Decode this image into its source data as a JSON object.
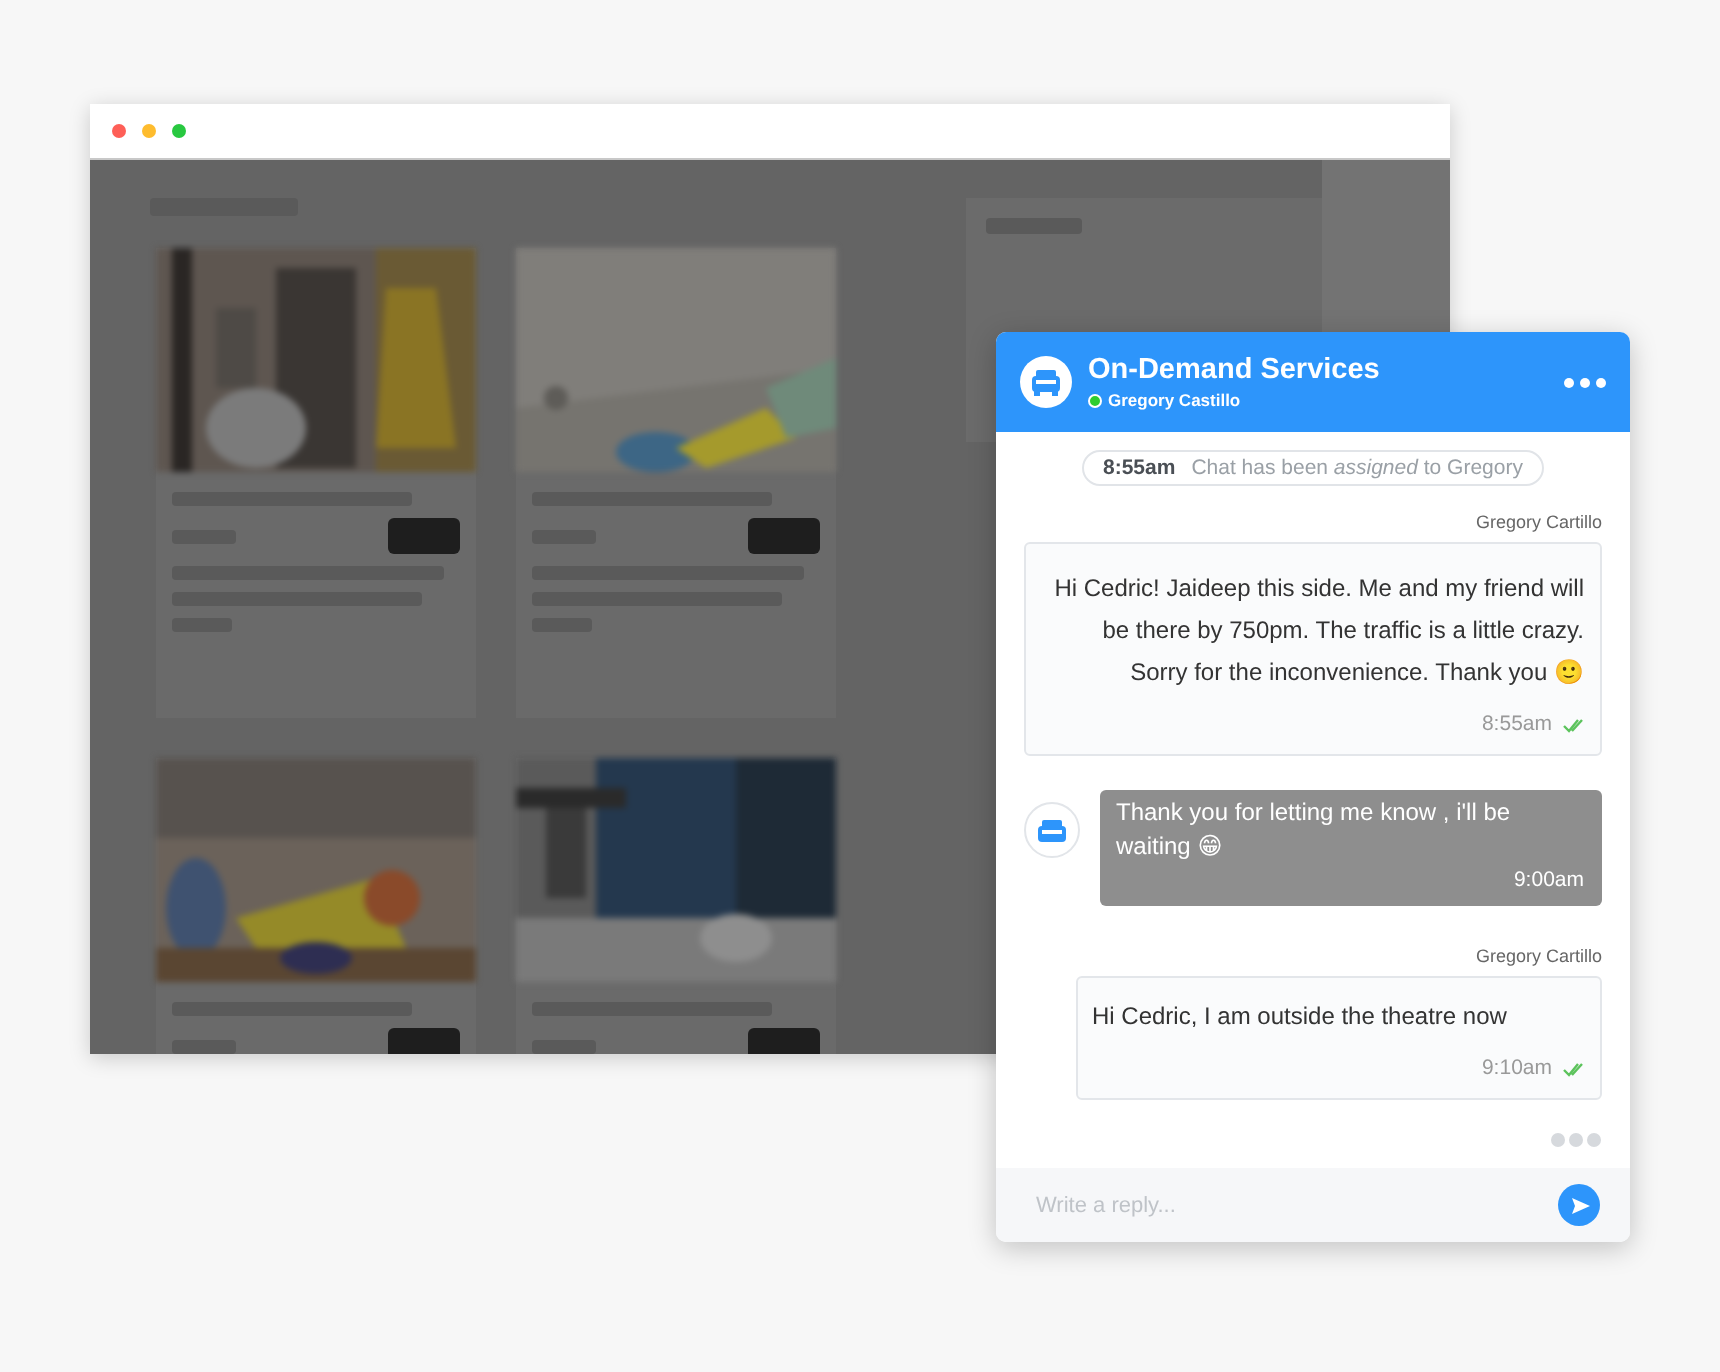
{
  "chat": {
    "title": "On-Demand Services",
    "agent": "Gregory Castillo",
    "online": true,
    "system_note": {
      "time": "8:55am",
      "text": "Chat has been *assigned* to Gregory"
    },
    "messages": [
      {
        "kind": "agent",
        "sender": "Gregory Cartillo",
        "text": "Hi Cedric! Jaideep this side. Me and my friend will be there by 750pm. The traffic is a little crazy. Sorry for the inconvenience. Thank you 🙂",
        "time": "8:55am",
        "read": true
      },
      {
        "kind": "customer",
        "text": "Thank you for letting me know , i'll be waiting 😁",
        "time": "9:00am"
      },
      {
        "kind": "agent",
        "sender": "Gregory Cartillo",
        "text": "Hi Cedric, I am outside the theatre now",
        "time": "9:10am",
        "read": true
      }
    ],
    "typing": true,
    "composer": {
      "placeholder": "Write a reply..."
    }
  }
}
